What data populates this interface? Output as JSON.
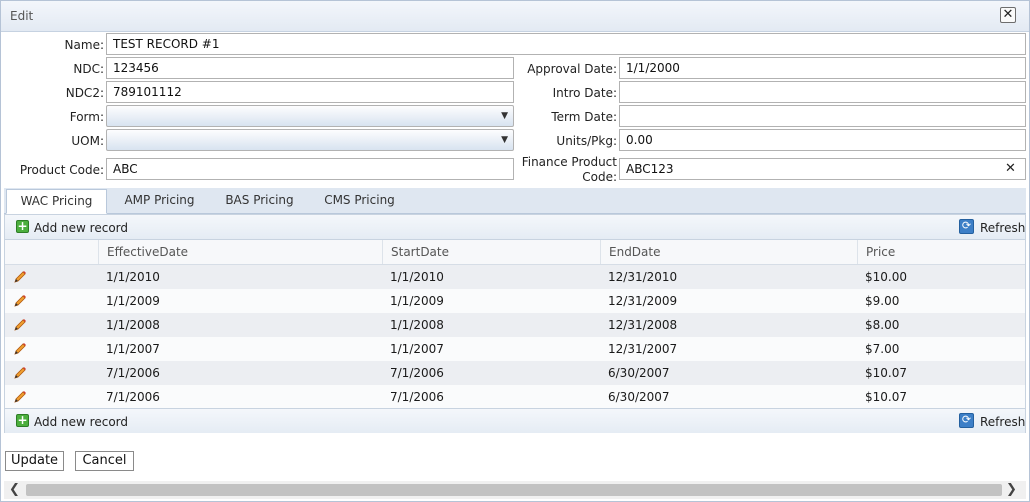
{
  "window": {
    "title": "Edit",
    "close_label": "✕"
  },
  "form": {
    "name_label": "Name:",
    "name_value": "TEST RECORD #1",
    "ndc_label": "NDC:",
    "ndc_value": "123456",
    "ndc2_label": "NDC2:",
    "ndc2_value": "789101112",
    "form_label": "Form:",
    "form_value": "",
    "uom_label": "UOM:",
    "uom_value": "",
    "product_code_label": "Product Code:",
    "product_code_value": "ABC",
    "approval_date_label": "Approval Date:",
    "approval_date_value": "1/1/2000",
    "intro_date_label": "Intro Date:",
    "intro_date_value": "",
    "term_date_label": "Term Date:",
    "term_date_value": "",
    "units_pkg_label": "Units/Pkg:",
    "units_pkg_value": "0.00",
    "finance_code_label_1": "Finance Product",
    "finance_code_label_2": "Code:",
    "finance_code_value": "ABC123",
    "clear_label": "✕"
  },
  "tabs": [
    "WAC Pricing",
    "AMP Pricing",
    "BAS Pricing",
    "CMS Pricing"
  ],
  "grid": {
    "add_label": "Add new record",
    "refresh_label": "Refresh",
    "columns": [
      "EffectiveDate",
      "StartDate",
      "EndDate",
      "Price"
    ],
    "rows": [
      [
        "1/1/2010",
        "1/1/2010",
        "12/31/2010",
        "$10.00"
      ],
      [
        "1/1/2009",
        "1/1/2009",
        "12/31/2009",
        "$9.00"
      ],
      [
        "1/1/2008",
        "1/1/2008",
        "12/31/2008",
        "$8.00"
      ],
      [
        "1/1/2007",
        "1/1/2007",
        "12/31/2007",
        "$7.00"
      ],
      [
        "7/1/2006",
        "7/1/2006",
        "6/30/2007",
        "$10.07"
      ],
      [
        "7/1/2006",
        "7/1/2006",
        "6/30/2007",
        "$10.07"
      ]
    ]
  },
  "actions": {
    "update_label": "Update",
    "cancel_label": "Cancel"
  },
  "icons": {
    "add": "add-icon",
    "refresh": "refresh-icon",
    "edit": "pencil-icon",
    "close": "close-icon"
  }
}
